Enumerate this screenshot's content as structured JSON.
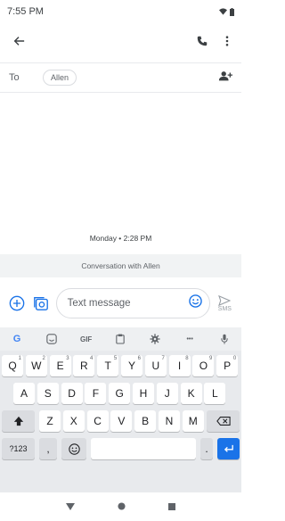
{
  "status_bar": {
    "time": "7:55 PM"
  },
  "app_bar": {
    "back_icon": "arrow-left-icon",
    "call_icon": "phone-icon",
    "more_icon": "more-vert-icon"
  },
  "recipients": {
    "to_label": "To",
    "chip": "Allen",
    "add_icon": "add-contact-icon"
  },
  "conversation": {
    "timestamp": "Monday • 2:28 PM",
    "banner": "Conversation with Allen"
  },
  "compose": {
    "placeholder": "Text message",
    "send_label": "SMS"
  },
  "keyboard": {
    "toolbar": [
      "G",
      "sticker",
      "GIF",
      "clipboard",
      "settings",
      "•••",
      "mic"
    ],
    "row1": [
      {
        "k": "Q",
        "n": "1"
      },
      {
        "k": "W",
        "n": "2"
      },
      {
        "k": "E",
        "n": "3"
      },
      {
        "k": "R",
        "n": "4"
      },
      {
        "k": "T",
        "n": "5"
      },
      {
        "k": "Y",
        "n": "6"
      },
      {
        "k": "U",
        "n": "7"
      },
      {
        "k": "I",
        "n": "8"
      },
      {
        "k": "O",
        "n": "9"
      },
      {
        "k": "P",
        "n": "0"
      }
    ],
    "row2": [
      "A",
      "S",
      "D",
      "F",
      "G",
      "H",
      "J",
      "K",
      "L"
    ],
    "row3": [
      "Z",
      "X",
      "C",
      "V",
      "B",
      "N",
      "M"
    ],
    "symbols_label": "?123",
    "comma": ",",
    "period": "."
  },
  "colors": {
    "accent": "#1a73e8",
    "keyboard_bg": "#e8eaed"
  }
}
